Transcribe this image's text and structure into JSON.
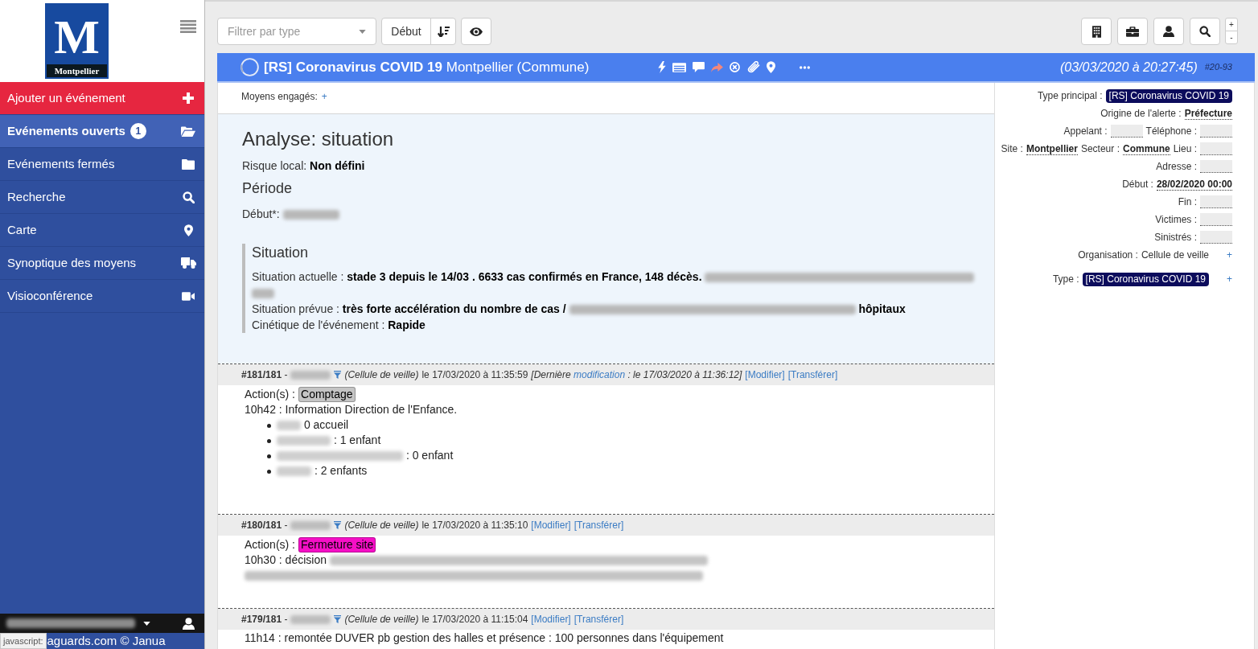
{
  "sidebar": {
    "logo": {
      "letter": "M",
      "wordmark": "Montpellier"
    },
    "items": [
      {
        "kind": "action",
        "label": "Ajouter un événement",
        "selected": false
      },
      {
        "kind": "nav",
        "label": "Evénements ouverts",
        "badge": "1",
        "selected": true
      },
      {
        "kind": "nav",
        "label": "Evénements fermés",
        "selected": false
      },
      {
        "kind": "nav",
        "label": "Recherche",
        "selected": false
      },
      {
        "kind": "nav",
        "label": "Carte",
        "selected": false
      },
      {
        "kind": "nav",
        "label": "Synoptique des moyens",
        "selected": false
      },
      {
        "kind": "nav",
        "label": "Visioconférence",
        "selected": false
      }
    ],
    "user_menu": {
      "parts": [
        {
          "kind": "redacted"
        }
      ]
    },
    "status_tooltip": "javascript:",
    "footer": "aguards.com © Janua"
  },
  "toolbar": {
    "filter": {
      "placeholder": "Filtrer par type"
    },
    "sort": {
      "label": "Début"
    },
    "zoom": [
      "+",
      "-"
    ]
  },
  "event": {
    "title": "**[RS] Coronavirus COVID 19** Montpellier (Commune)",
    "date": "(03/03/2020 à 20:27:45)",
    "ref": "#20-93"
  },
  "resources": {
    "label": "Moyens engagés:",
    "add": "+"
  },
  "analysis": {
    "title": "Analyse: situation",
    "risk": {
      "label": "Risque local:",
      "parts": [
        {
          "kind": "bold",
          "text": "Non défini"
        }
      ]
    },
    "period": {
      "title": "Période",
      "start": {
        "label": "Début*:",
        "parts": [
          {
            "kind": "redacted"
          }
        ]
      }
    },
    "situation": {
      "title": "Situation",
      "lines": [
        {
          "label": "Situation actuelle :",
          "parts": [
            {
              "kind": "bold",
              "text": "stade 3 depuis le 14/03 . 6633 cas confirmés en France, 148 décès."
            },
            {
              "kind": "redacted"
            },
            {
              "kind": "redacted"
            }
          ]
        },
        {
          "label": "Situation prévue :",
          "parts": [
            {
              "kind": "bold",
              "text": "très forte accélération du nombre de cas /"
            },
            {
              "kind": "redacted"
            },
            {
              "kind": "bold",
              "text": "hôpitaux"
            }
          ]
        },
        {
          "label": "Cinétique de l'événement :",
          "parts": [
            {
              "kind": "bold",
              "text": "Rapide"
            }
          ]
        }
      ]
    }
  },
  "entries": [
    {
      "number": "**#181/181** -",
      "author": {
        "kind": "redacted"
      },
      "cell": "(Cellule de veille)",
      "date": "le 17/03/2020 à 11:35:59",
      "modified": {
        "before": "[Dernière",
        "link": "modification",
        "after": ": le 17/03/2020 à 11:36:12]"
      },
      "links": [
        "[Modifier]",
        "[Transférer]"
      ],
      "action": {
        "label": "Action(s) :",
        "tag": "Comptage",
        "color": "#c4c4c4"
      },
      "body": [
        {
          "kind": "line",
          "parts": [
            {
              "kind": "text",
              "text": "10h42 : Information Direction de l'Enfance."
            }
          ]
        },
        {
          "kind": "bullets",
          "items": [
            [
              {
                "kind": "redacted"
              },
              {
                "kind": "text",
                "text": "0 accueil"
              }
            ],
            [
              {
                "kind": "redacted"
              },
              {
                "kind": "text",
                "text": ": 1 enfant"
              }
            ],
            [
              {
                "kind": "redacted"
              },
              {
                "kind": "text",
                "text": ": 0 enfant"
              }
            ],
            [
              {
                "kind": "redacted"
              },
              {
                "kind": "text",
                "text": ": 2 enfants"
              }
            ]
          ]
        }
      ]
    },
    {
      "number": "**#180/181** -",
      "author": {
        "kind": "redacted"
      },
      "cell": "(Cellule de veille)",
      "date": "le 17/03/2020 à 11:35:10",
      "links": [
        "[Modifier]",
        "[Transférer]"
      ],
      "action": {
        "label": "Action(s) :",
        "tag": "Fermeture site",
        "color": "#f50fc6"
      },
      "body": [
        {
          "kind": "line",
          "parts": [
            {
              "kind": "text",
              "text": "10h30 : décision"
            },
            {
              "kind": "redacted"
            }
          ]
        },
        {
          "kind": "line",
          "parts": [
            {
              "kind": "redacted"
            }
          ]
        }
      ]
    },
    {
      "number": "**#179/181** -",
      "author": {
        "kind": "redacted"
      },
      "cell": "(Cellule de veille)",
      "date": "le 17/03/2020 à 11:15:04",
      "links": [
        "[Modifier]",
        "[Transférer]"
      ],
      "body": [
        {
          "kind": "line",
          "parts": [
            {
              "kind": "text",
              "text": "11h14 : remontée DUVER pb gestion des halles et présence : 100 personnes dans l'équipement"
            }
          ]
        }
      ]
    }
  ],
  "details": {
    "rows": [
      {
        "fields": [
          {
            "kind": "badge",
            "label": "Type principal :",
            "value": "[RS] Coronavirus COVID 19"
          }
        ]
      },
      {
        "fields": [
          {
            "kind": "editable",
            "label": "Origine de l'alerte :",
            "value": "Préfecture"
          }
        ]
      },
      {
        "fields": [
          {
            "kind": "empty",
            "label": "Appelant :"
          },
          {
            "kind": "empty",
            "label": "Téléphone :"
          }
        ]
      },
      {
        "fields": [
          {
            "kind": "editable",
            "label": "Site :",
            "value": "Montpellier"
          },
          {
            "kind": "editable",
            "label": "Secteur :",
            "value": "Commune"
          },
          {
            "kind": "empty",
            "label": "Lieu :"
          }
        ]
      },
      {
        "fields": [
          {
            "kind": "empty",
            "label": "Adresse :"
          }
        ]
      },
      {
        "fields": [
          {
            "kind": "editable",
            "label": "Début :",
            "value": "28/02/2020 00:00"
          }
        ]
      },
      {
        "fields": [
          {
            "kind": "empty",
            "label": "Fin :"
          }
        ]
      },
      {
        "fields": [
          {
            "kind": "empty",
            "label": "Victimes :"
          }
        ]
      },
      {
        "fields": [
          {
            "kind": "empty",
            "label": "Sinistrés :"
          }
        ]
      },
      {
        "add": "+",
        "fields": [
          {
            "kind": "plain",
            "label": "Organisation :",
            "value": "Cellule de veille"
          }
        ]
      },
      {
        "add": "+",
        "fields": [
          {
            "kind": "badge",
            "label": "Type :",
            "value": "[RS] Coronavirus COVID 19"
          }
        ]
      }
    ]
  }
}
